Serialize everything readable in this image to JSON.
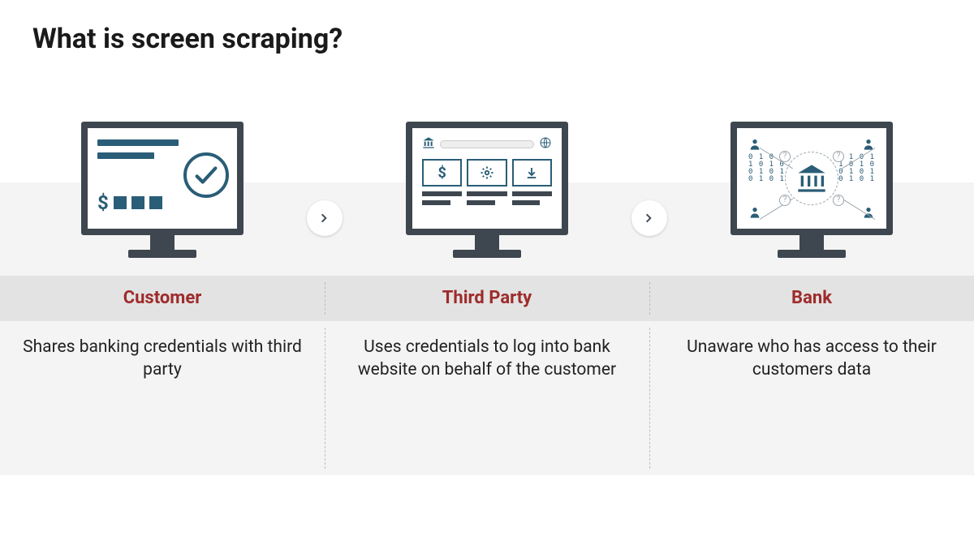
{
  "title": "What is screen scraping?",
  "steps": [
    {
      "label": "Customer",
      "description": "Shares banking credentials with third party"
    },
    {
      "label": "Third Party",
      "description": "Uses credentials to log into bank website on behalf of the customer"
    },
    {
      "label": "Bank",
      "description": "Unaware who has access to their customers data"
    }
  ],
  "binary_pattern": "0 1 0 1\n1 0 1 0\n0 1 0 1\n0 1 0 1"
}
